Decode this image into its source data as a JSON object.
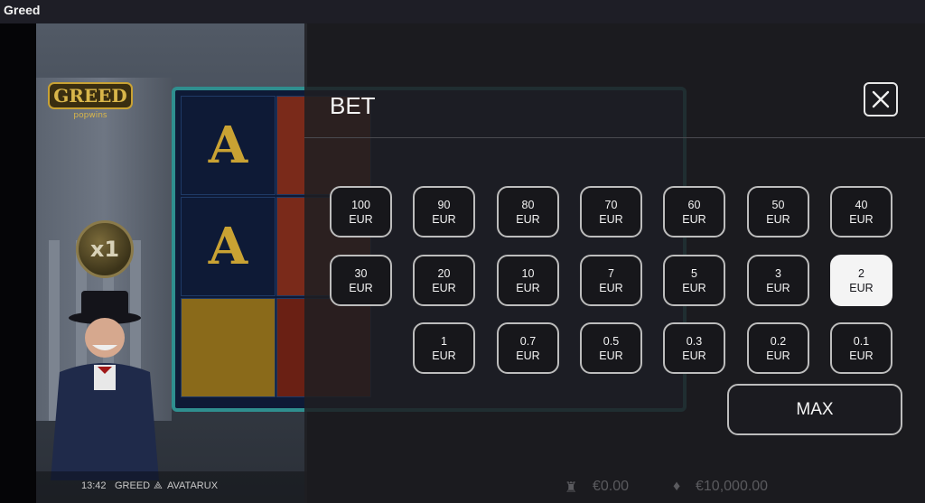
{
  "window": {
    "title": "Greed"
  },
  "game": {
    "logo_text": "GREED",
    "logo_sub": "popwins",
    "multiplier": "x1",
    "footer": {
      "time": "13:42",
      "game_name": "GREED",
      "provider": "AVATARUX"
    },
    "win_display": "€0.00",
    "balance_display": "€10,000.00"
  },
  "bet_panel": {
    "title": "BET",
    "currency": "EUR",
    "selected": "2",
    "rows": [
      [
        "100",
        "90",
        "80",
        "70",
        "60",
        "50",
        "40"
      ],
      [
        "30",
        "20",
        "10",
        "7",
        "5",
        "3",
        "2"
      ],
      [
        "1",
        "0.7",
        "0.5",
        "0.3",
        "0.2",
        "0.1"
      ]
    ],
    "max_label": "MAX"
  },
  "colors": {
    "selected_chip": "#f4f4f4",
    "overlay": "#1e1e22",
    "reel_frame": "#2f8f8f"
  }
}
